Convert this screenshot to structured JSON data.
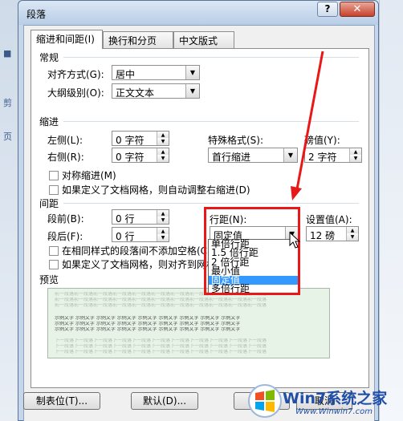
{
  "background": {
    "ribbon_left_labels": [
      "页",
      "剪"
    ]
  },
  "dialog": {
    "title": "段落",
    "help_label": "?",
    "close_label": "✕",
    "tabs": [
      {
        "label": "缩进和间距(I)",
        "active": true
      },
      {
        "label": "换行和分页(P)",
        "active": false
      },
      {
        "label": "中文版式(H)",
        "active": false
      }
    ],
    "general": {
      "section_label": "常规",
      "alignment_label": "对齐方式(G):",
      "alignment_value": "居中",
      "outline_label": "大纲级别(O):",
      "outline_value": "正文文本"
    },
    "indent": {
      "section_label": "缩进",
      "left_label": "左侧(L):",
      "left_value": "0 字符",
      "right_label": "右侧(R):",
      "right_value": "0 字符",
      "special_label": "特殊格式(S):",
      "special_value": "首行缩进",
      "by_label": "磅值(Y):",
      "by_value": "2 字符",
      "mirror_label": "对称缩进(M)",
      "auto_adjust_label": "如果定义了文档网格，则自动调整右缩进(D)"
    },
    "spacing": {
      "section_label": "间距",
      "before_label": "段前(B):",
      "before_value": "0 行",
      "after_label": "段后(F):",
      "after_value": "0 行",
      "line_spacing_label": "行距(N):",
      "line_spacing_value": "固定值",
      "at_label": "设置值(A):",
      "at_value": "12 磅",
      "no_space_label": "在相同样式的段落间不添加空格(C)",
      "snap_grid_label": "如果定义了文档网格，则对齐到网格(W)",
      "dropdown_options": [
        "单倍行距",
        "1.5 倍行距",
        "2 倍行距",
        "最小值",
        "固定值",
        "多倍行距"
      ],
      "dropdown_selected": "固定值"
    },
    "preview": {
      "section_label": "预览",
      "prev_para_text": "前一段落前一段落前一段落前一段落前一段落前一段落前一段落前一段落前一段落前一段落前一段落",
      "sample_text": "示例文字 示例文字 示例文字 示例文字 示例文字 示例文字 示例文字 示例文字 示例文字",
      "next_para_text": "下一段落下一段落下一段落下一段落下一段落下一段落下一段落下一段落下一段落下一段落下一段落"
    },
    "buttons": {
      "tabs_label": "制表位(T)...",
      "default_label": "默认(D)...",
      "ok_label": "确定",
      "cancel_label": "取消"
    }
  },
  "watermark": {
    "brand": "Win7系统之家",
    "url": "Www.Winwin7.com"
  },
  "colors": {
    "highlight_box": "#e81818",
    "selection": "#3399ff",
    "preview_bg": "#e7f3e7"
  }
}
